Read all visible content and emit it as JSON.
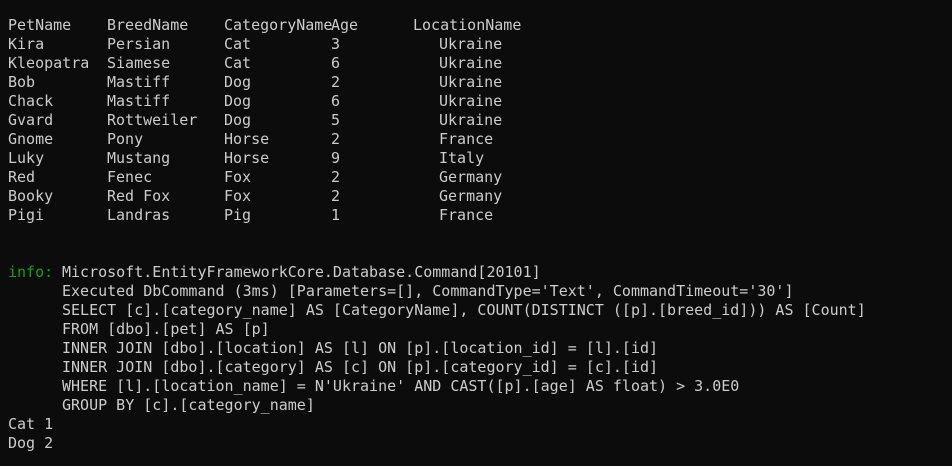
{
  "table": {
    "headers": [
      "PetName",
      "BreedName",
      "CategoryName",
      "Age",
      "LocationName"
    ],
    "rows": [
      [
        "Kira",
        "Persian",
        "Cat",
        "3",
        "Ukraine"
      ],
      [
        "Kleopatra",
        "Siamese",
        "Cat",
        "6",
        "Ukraine"
      ],
      [
        "Bob",
        "Mastiff",
        "Dog",
        "2",
        "Ukraine"
      ],
      [
        "Chack",
        "Mastiff",
        "Dog",
        "6",
        "Ukraine"
      ],
      [
        "Gvard",
        "Rottweiler",
        "Dog",
        "5",
        "Ukraine"
      ],
      [
        "Gnome",
        "Pony",
        "Horse",
        "2",
        "France"
      ],
      [
        "Luky",
        "Mustang",
        "Horse",
        "9",
        "Italy"
      ],
      [
        "Red",
        "Fenec",
        "Fox",
        "2",
        "Germany"
      ],
      [
        "Booky",
        "Red Fox",
        "Fox",
        "2",
        "Germany"
      ],
      [
        "Pigi",
        "Landras",
        "Pig",
        "1",
        "France"
      ]
    ]
  },
  "log": {
    "level": "info:",
    "lines": [
      "Microsoft.EntityFrameworkCore.Database.Command[20101]",
      "Executed DbCommand (3ms) [Parameters=[], CommandType='Text', CommandTimeout='30']",
      "SELECT [c].[category_name] AS [CategoryName], COUNT(DISTINCT ([p].[breed_id])) AS [Count]",
      "FROM [dbo].[pet] AS [p]",
      "INNER JOIN [dbo].[location] AS [l] ON [p].[location_id] = [l].[id]",
      "INNER JOIN [dbo].[category] AS [c] ON [p].[category_id] = [c].[id]",
      "WHERE [l].[location_name] = N'Ukraine' AND CAST([p].[age] AS float) > 3.0E0",
      "GROUP BY [c].[category_name]"
    ]
  },
  "results": [
    "Cat 1",
    "Dog 2"
  ],
  "colors": {
    "background": "#0c0c0c",
    "foreground": "#cccccc",
    "info": "#13a10e"
  }
}
